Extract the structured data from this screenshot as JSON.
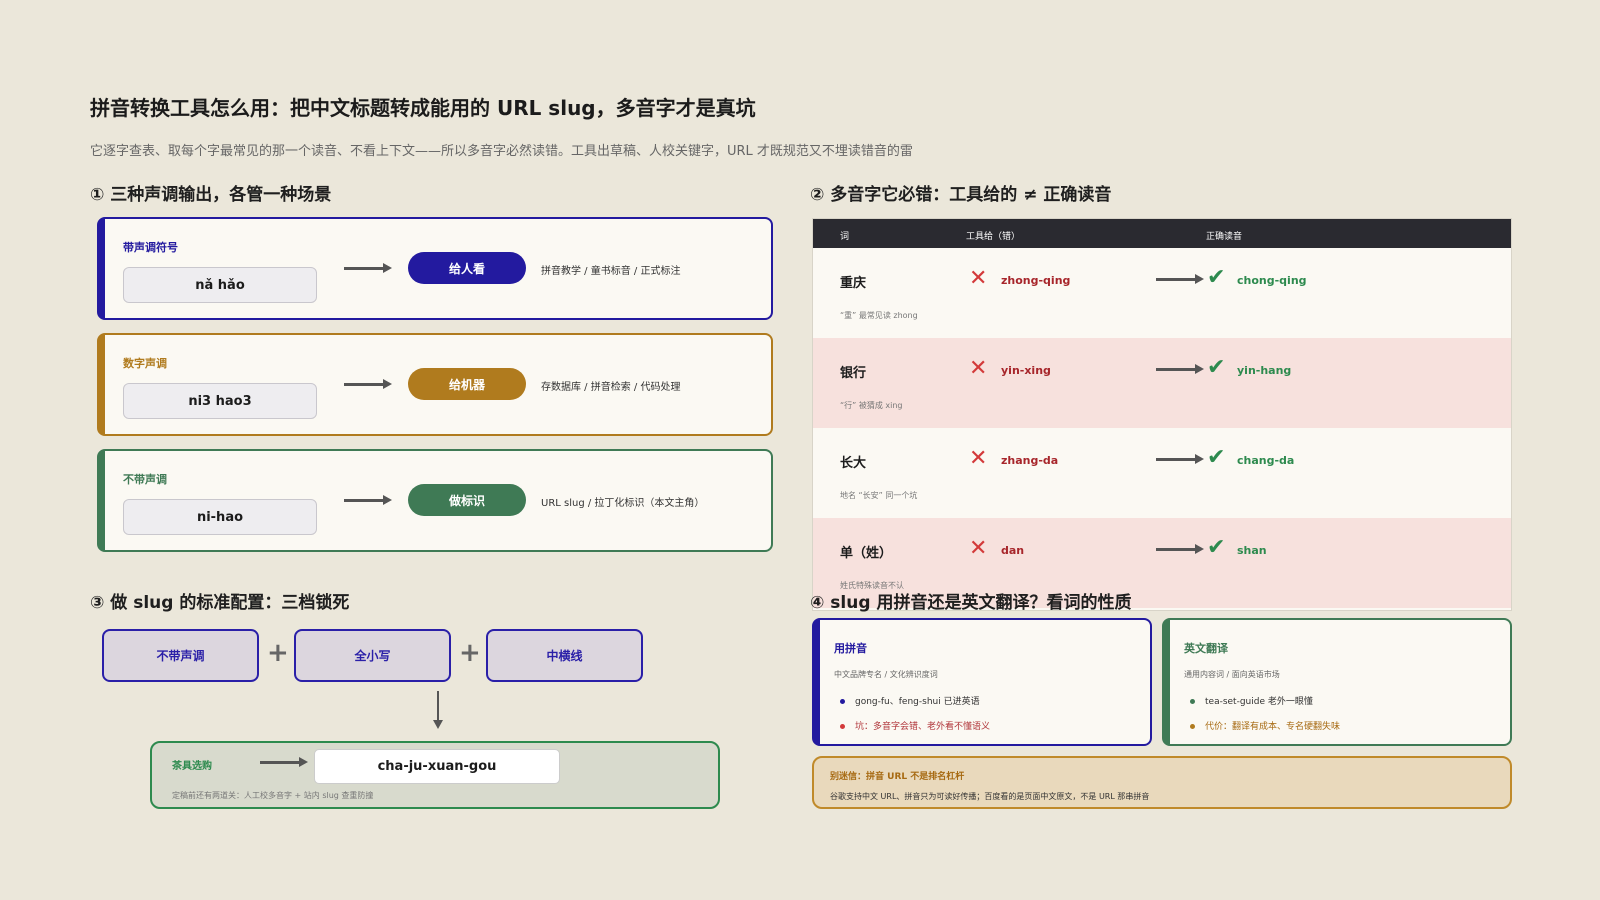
{
  "header": {
    "title": "拼音转换工具怎么用：把中文标题转成能用的 URL slug，多音字才是真坑",
    "subtitle": "它逐字查表、取每个字最常见的那一个读音、不看上下文——所以多音字必然读错。工具出草稿、人校关键字，URL 才既规范又不埋读错音的雷"
  },
  "section1": {
    "heading": "① 三种声调输出，各管一种场景",
    "cards": [
      {
        "label": "带声调符号",
        "example": "nǎ hǎo",
        "pill": "给人看",
        "desc": "拼音教学 / 童书标音 / 正式标注",
        "color": "#231a9f"
      },
      {
        "label": "数字声调",
        "example": "ni3 hao3",
        "pill": "给机器",
        "desc": "存数据库 / 拼音检索 / 代码处理",
        "color": "#b07b1e"
      },
      {
        "label": "不带声调",
        "example": "ni-hao",
        "pill": "做标识",
        "desc": "URL slug / 拉丁化标识（本文主角）",
        "color": "#3f7a55"
      }
    ]
  },
  "section2": {
    "heading": "② 多音字它必错：工具给的 ≠ 正确读音",
    "columns": {
      "word": "词",
      "tool": "工具给（错）",
      "correct": "正确读音"
    },
    "rows": [
      {
        "word": "重庆",
        "wrong": "zhong-qing",
        "right": "chong-qing",
        "note": "“重” 最常见读 zhong"
      },
      {
        "word": "银行",
        "wrong": "yin-xing",
        "right": "yin-hang",
        "note": "“行” 被猜成 xing"
      },
      {
        "word": "长大",
        "wrong": "zhang-da",
        "right": "chang-da",
        "note": "地名 “长安” 同一个坑"
      },
      {
        "word": "单（姓）",
        "wrong": "dan",
        "right": "shan",
        "note": "姓氏特殊读音不认"
      }
    ]
  },
  "section3": {
    "heading": "③ 做 slug 的标准配置：三档锁死",
    "configs": [
      "不带声调",
      "全小写",
      "中横线"
    ],
    "result": {
      "label": "茶具选购",
      "slug": "cha-ju-xuan-gou",
      "note": "定稿前还有两道关：人工校多音字 + 站内 slug 查重防撞"
    }
  },
  "section4": {
    "heading": "④ slug 用拼音还是英文翻译？看词的性质",
    "pinyin": {
      "title": "用拼音",
      "sub": "中文品牌专名 / 文化辨识度词",
      "bullets": [
        "gong-fu、feng-shui 已进英语",
        "坑：多音字会错、老外看不懂语义"
      ]
    },
    "english": {
      "title": "英文翻译",
      "sub": "通用内容词 / 面向英语市场",
      "bullets": [
        "tea-set-guide 老外一眼懂",
        "代价：翻译有成本、专名硬翻失味"
      ]
    },
    "tip": {
      "title": "别迷信：拼音 URL 不是排名杠杆",
      "body": "谷歌支持中文 URL、拼音只为可读好传播；百度看的是页面中文原文，不是 URL 那串拼音"
    }
  },
  "colors": {
    "indigo": "#231a9f",
    "amber": "#b07b1e",
    "green": "#3f7a55",
    "red": "#d33a3a",
    "check": "#2d8a4e",
    "background": "#ebe7da"
  }
}
